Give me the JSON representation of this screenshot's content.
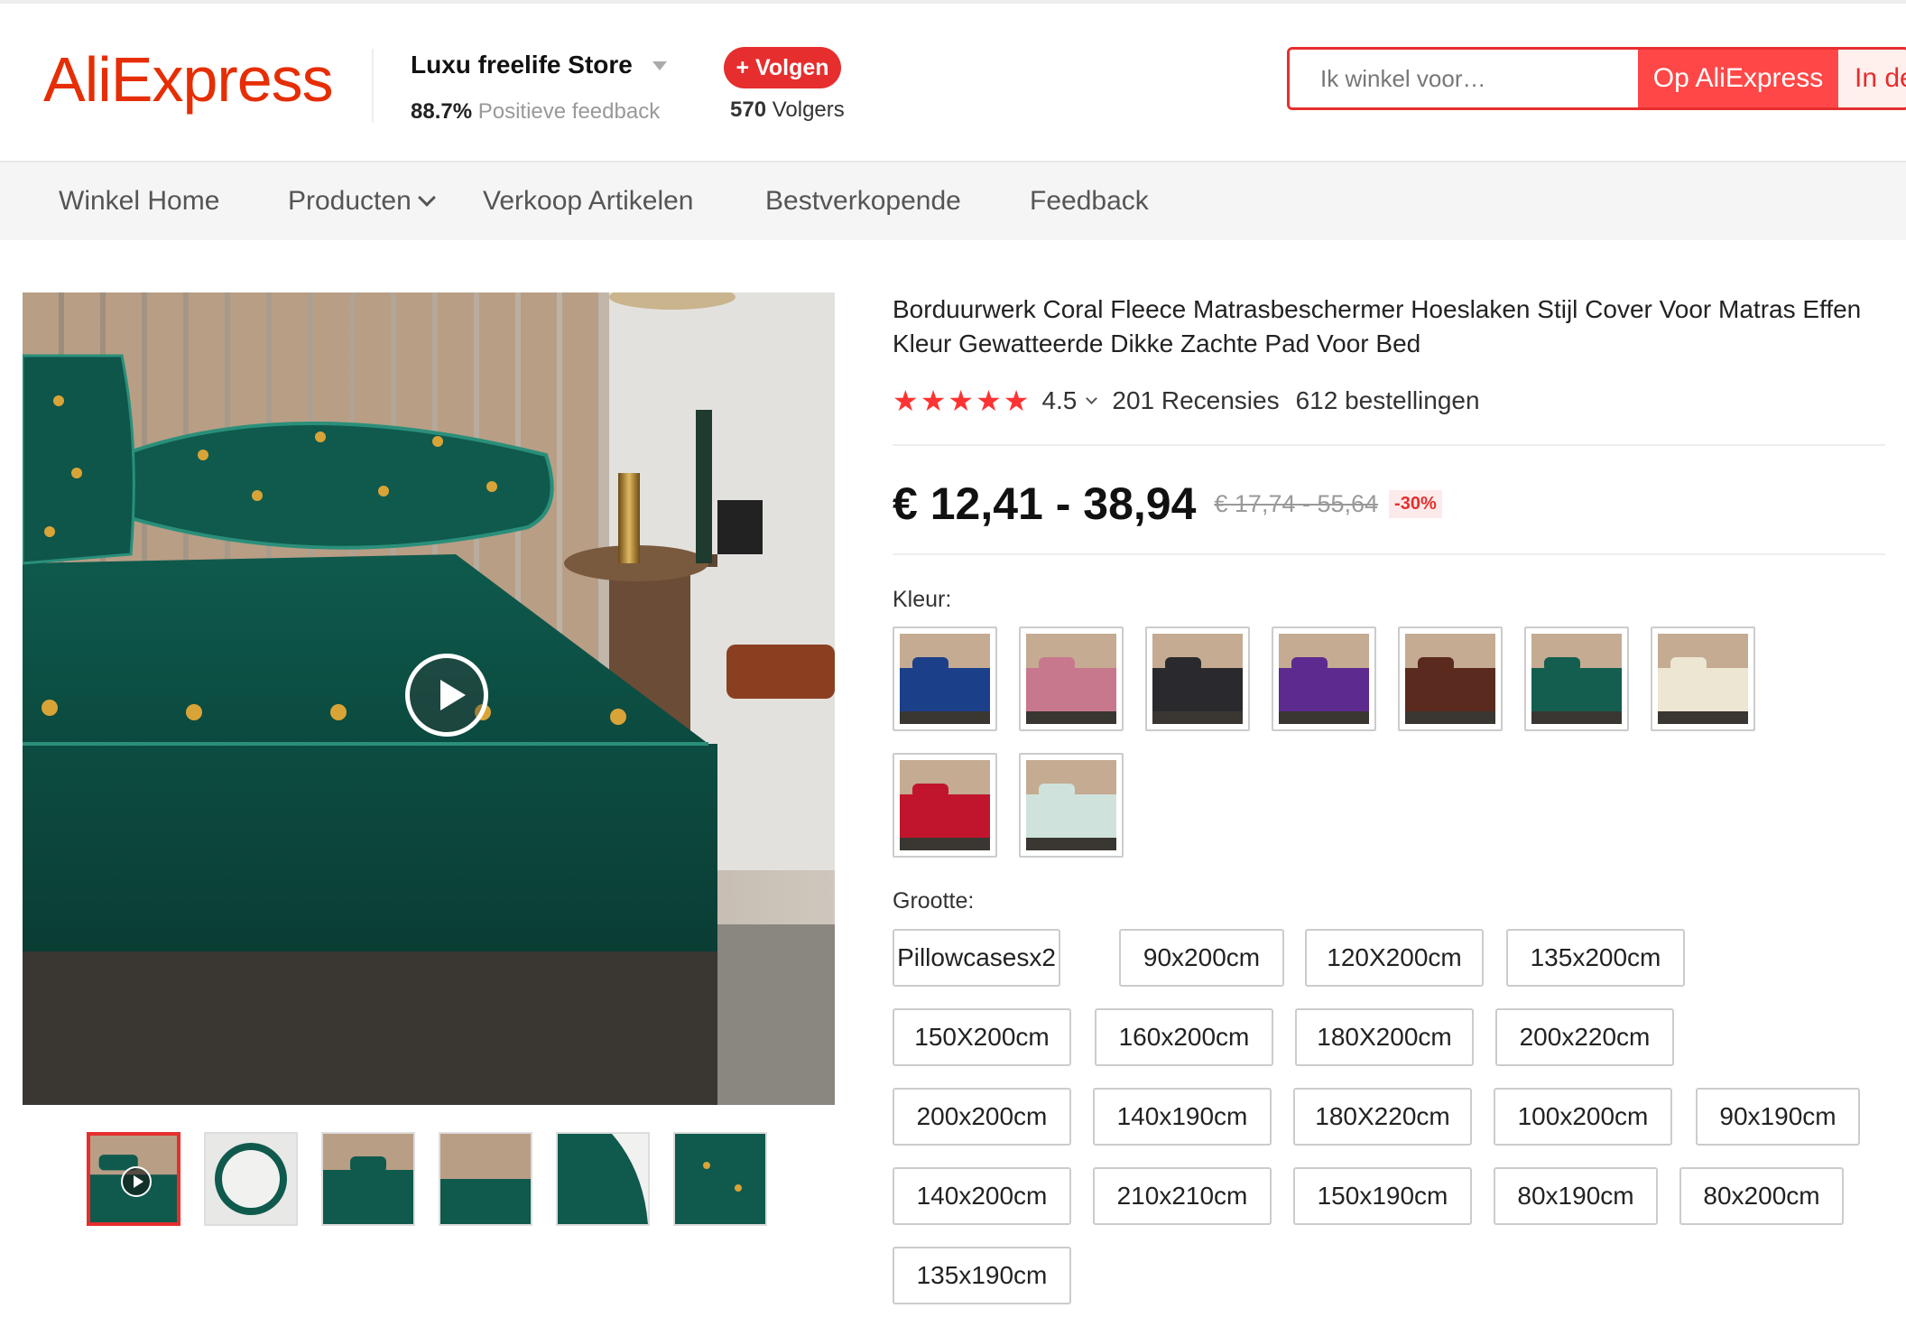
{
  "header": {
    "logo": "AliExpress",
    "store_name": "Luxu freelife Store",
    "feedback_percent": "88.7%",
    "feedback_label": "Positieve feedback",
    "follow_label": "+ Volgen",
    "followers_count": "570",
    "followers_label": "Volgers",
    "search_placeholder": "Ik winkel voor…",
    "search_btn_aliexpress": "Op AliExpress",
    "search_btn_store": "In deze winkel"
  },
  "nav": {
    "items": [
      "Winkel Home",
      "Producten",
      "Verkoop Artikelen",
      "Bestverkopende",
      "Feedback"
    ]
  },
  "product": {
    "title": "Borduurwerk Coral Fleece Matrasbeschermer Hoeslaken Stijl Cover Voor Matras Effen Kleur Gewatteerde Dikke Zachte Pad Voor Bed",
    "stars": "★★★★★",
    "rating": "4.5",
    "reviews": "201 Recensies",
    "orders": "612 bestellingen",
    "price": "€ 12,41 - 38,94",
    "price_old": "€ 17,74 - 55,64",
    "discount": "-30%",
    "color_label": "Kleur:",
    "size_label": "Grootte:",
    "colors": [
      "#1c3f8a",
      "#c7788c",
      "#2a2a2e",
      "#5d2a8f",
      "#5a2a1e",
      "#145e50",
      "#ece6d2",
      "#c0152c",
      "#cfe3dc"
    ],
    "sizes": [
      "Pillowcasesx2",
      "90x200cm",
      "120X200cm",
      "135x200cm",
      "150X200cm",
      "160x200cm",
      "180X200cm",
      "200x220cm",
      "200x200cm",
      "140x190cm",
      "180X220cm",
      "100x200cm",
      "90x190cm",
      "140x200cm",
      "210x210cm",
      "150x190cm",
      "80x190cm",
      "80x200cm",
      "135x190cm"
    ]
  }
}
